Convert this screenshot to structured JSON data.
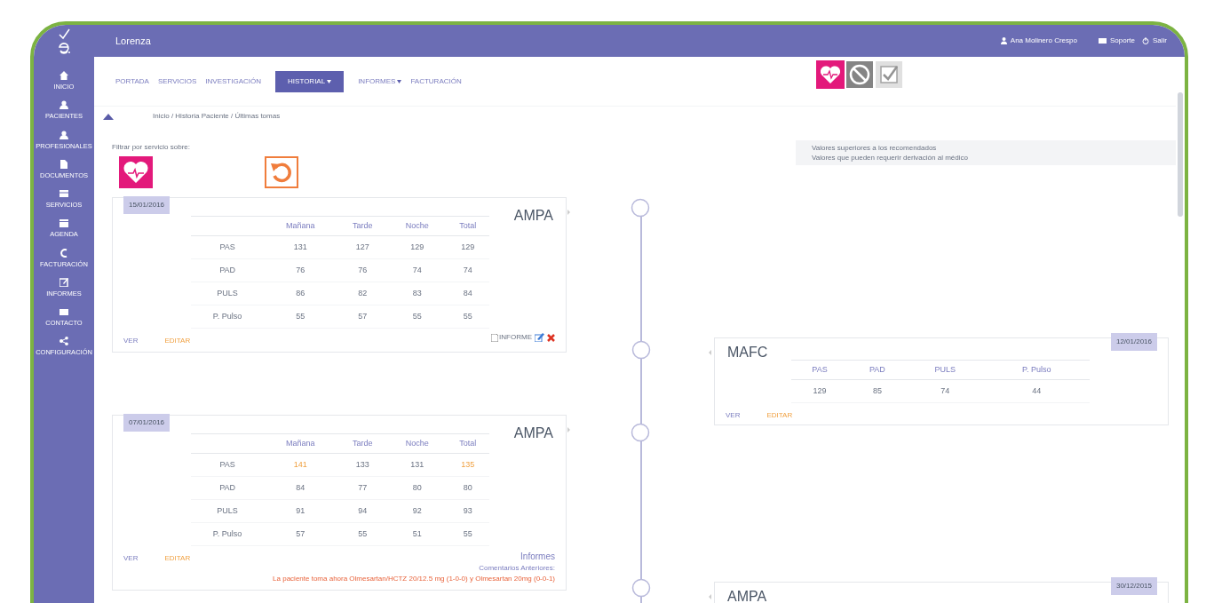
{
  "header": {
    "brand": "Lorenza",
    "user": "Ana Molinero Crespo",
    "links": [
      {
        "kind": "support",
        "label": "Soporte"
      },
      {
        "kind": "logout",
        "label": "Salir"
      }
    ]
  },
  "sidebar": [
    {
      "kind": "home",
      "label": "INICIO"
    },
    {
      "kind": "user",
      "label": "PACIENTES"
    },
    {
      "kind": "user",
      "label": "PROFESIONALES"
    },
    {
      "kind": "doc",
      "label": "DOCUMENTOS"
    },
    {
      "kind": "list",
      "label": "SERVICIOS"
    },
    {
      "kind": "calendar",
      "label": "AGENDA"
    },
    {
      "kind": "euro",
      "label": "FACTURACIÓN"
    },
    {
      "kind": "edit",
      "label": "INFORMES"
    },
    {
      "kind": "mail",
      "label": "CONTACTO"
    },
    {
      "kind": "share",
      "label": "CONFIGURACIÓN"
    }
  ],
  "nav": [
    {
      "label": "PORTADA",
      "selected": false,
      "dropdown": false
    },
    {
      "label": "SERVICIOS",
      "selected": false,
      "dropdown": false
    },
    {
      "label": "INVESTIGACIÓN",
      "selected": false,
      "dropdown": false
    },
    {
      "label": "HISTORIAL",
      "selected": true,
      "dropdown": true
    },
    {
      "label": "INFORMES",
      "selected": false,
      "dropdown": true
    },
    {
      "label": "FACTURACIÓN",
      "selected": false,
      "dropdown": false
    }
  ],
  "service_icons": [
    {
      "kind": "heart",
      "selected": true
    },
    {
      "kind": "no-smoking",
      "selected": false
    },
    {
      "kind": "check",
      "selected": false
    }
  ],
  "breadcrumb": "Inicio / Historia Paciente / Últimas tomas",
  "filter": {
    "label": "Filtrar por servicio sobre:"
  },
  "legend": [
    "Valores superiores a los recomendados",
    "Valores que pueden requerir derivación al médico"
  ],
  "left_cards": [
    {
      "date": "15/01/2016",
      "title": "AMPA",
      "columns": [
        "Mañana",
        "Tarde",
        "Noche",
        "Total"
      ],
      "rows": [
        {
          "label": "PAS",
          "cells": [
            {
              "value": "131",
              "high": false
            },
            {
              "value": "127",
              "high": false
            },
            {
              "value": "129",
              "high": false
            },
            {
              "value": "129",
              "high": false
            }
          ]
        },
        {
          "label": "PAD",
          "cells": [
            {
              "value": "76",
              "high": false
            },
            {
              "value": "76",
              "high": false
            },
            {
              "value": "74",
              "high": false
            },
            {
              "value": "74",
              "high": false
            }
          ]
        },
        {
          "label": "PULS",
          "cells": [
            {
              "value": "86",
              "high": false
            },
            {
              "value": "82",
              "high": false
            },
            {
              "value": "83",
              "high": false
            },
            {
              "value": "84",
              "high": false
            }
          ]
        },
        {
          "label": "P. Pulso",
          "cells": [
            {
              "value": "55",
              "high": false
            },
            {
              "value": "57",
              "high": false
            },
            {
              "value": "55",
              "high": false
            },
            {
              "value": "55",
              "high": false
            }
          ]
        }
      ],
      "links": [
        "VER",
        "EDITAR"
      ],
      "footer": {
        "kind": "actions",
        "label": "INFORME"
      }
    },
    {
      "date": "07/01/2016",
      "title": "AMPA",
      "columns": [
        "Mañana",
        "Tarde",
        "Noche",
        "Total"
      ],
      "rows": [
        {
          "label": "PAS",
          "cells": [
            {
              "value": "141",
              "high": true
            },
            {
              "value": "133",
              "high": false
            },
            {
              "value": "131",
              "high": false
            },
            {
              "value": "135",
              "high": true
            }
          ]
        },
        {
          "label": "PAD",
          "cells": [
            {
              "value": "84",
              "high": false
            },
            {
              "value": "77",
              "high": false
            },
            {
              "value": "80",
              "high": false
            },
            {
              "value": "80",
              "high": false
            }
          ]
        },
        {
          "label": "PULS",
          "cells": [
            {
              "value": "91",
              "high": false
            },
            {
              "value": "94",
              "high": false
            },
            {
              "value": "92",
              "high": false
            },
            {
              "value": "93",
              "high": false
            }
          ]
        },
        {
          "label": "P. Pulso",
          "cells": [
            {
              "value": "57",
              "high": false
            },
            {
              "value": "55",
              "high": false
            },
            {
              "value": "51",
              "high": false
            },
            {
              "value": "55",
              "high": false
            }
          ]
        }
      ],
      "links": [
        "VER",
        "EDITAR"
      ],
      "footer": {
        "kind": "notes",
        "title": "Informes",
        "subtitle": "Comentarios Anteriores:",
        "note": "La paciente toma ahora Olmesartan/HCTZ 20/12.5 mg (1-0-0) y Olmesartan 20mg (0-0-1)"
      }
    }
  ],
  "right_cards": [
    {
      "date": "12/01/2016",
      "title": "MAFC",
      "columns": [
        "PAS",
        "PAD",
        "PULS",
        "P. Pulso"
      ],
      "rows": [
        {
          "cells": [
            {
              "value": "129",
              "high": false
            },
            {
              "value": "85",
              "high": false
            },
            {
              "value": "74",
              "high": false
            },
            {
              "value": "44",
              "high": false
            }
          ]
        }
      ],
      "links": [
        "VER",
        "EDITAR"
      ]
    },
    {
      "date": "30/12/2015",
      "title": "AMPA"
    }
  ]
}
